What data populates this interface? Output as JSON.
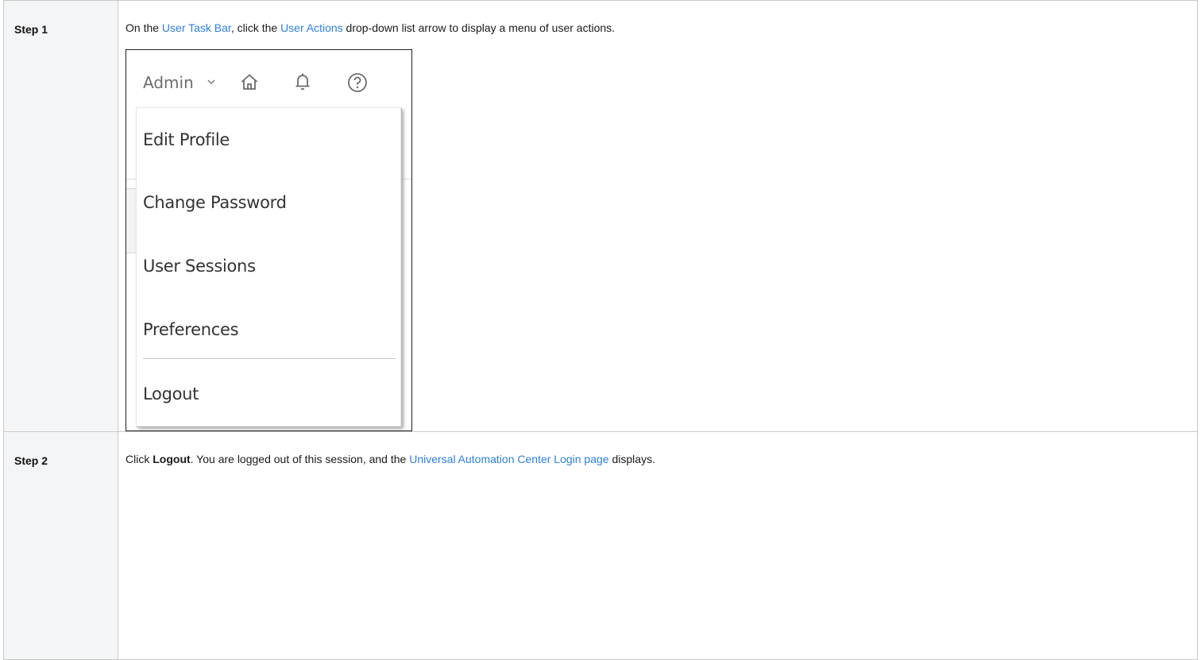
{
  "steps": [
    {
      "label": "Step 1",
      "text_before": "On the ",
      "link1": "User Task Bar",
      "text_mid": ", click the ",
      "link2": "User Actions",
      "text_after": " drop-down list arrow to display a menu of user actions."
    },
    {
      "label": "Step  2",
      "text_before": "Click ",
      "bold": "Logout",
      "text_mid": ". You are logged out of this session, and the ",
      "link1": "Universal Automation Center Login page",
      "text_after": " displays."
    }
  ],
  "screenshot": {
    "user_name": "Admin",
    "icons": [
      "chevron-down-icon",
      "home-icon",
      "bell-icon",
      "help-icon"
    ],
    "menu_items": [
      "Edit Profile",
      "Change Password",
      "User Sessions",
      "Preferences",
      "Logout"
    ]
  },
  "colors": {
    "link": "#2d7fe3",
    "label_bg": "#f4f5f7",
    "border": "#c9c9c9"
  }
}
